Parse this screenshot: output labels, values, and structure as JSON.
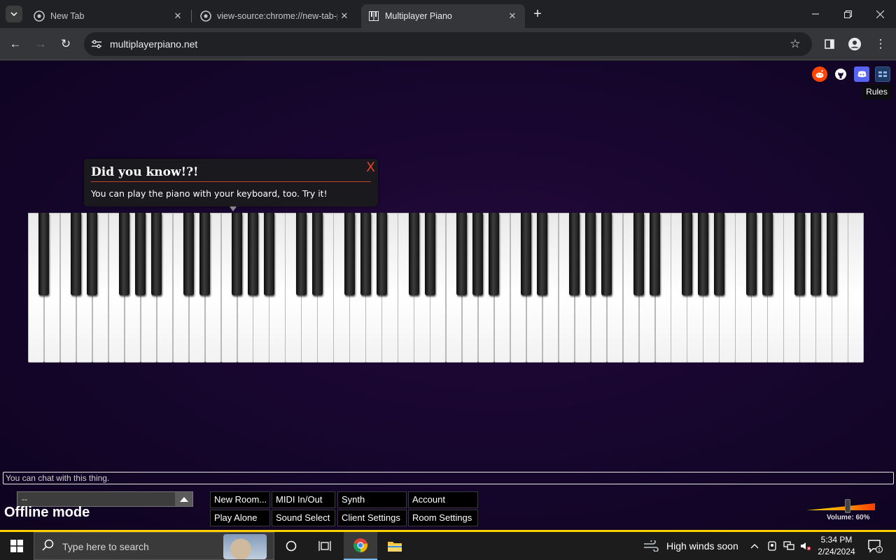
{
  "browser": {
    "tabs": [
      {
        "title": "New Tab",
        "active": false
      },
      {
        "title": "view-source:chrome://new-tab-page/",
        "active": false
      },
      {
        "title": "Multiplayer Piano",
        "active": true
      }
    ],
    "url": "multiplayerpiano.net"
  },
  "page": {
    "rules_label": "Rules",
    "tooltip": {
      "title": "Did you know!?!",
      "body": "You can play the piano with your keyboard, too. Try it!",
      "close": "X"
    },
    "piano": {
      "white_keys": 52,
      "black_keys": 36
    },
    "chat_placeholder": "You can chat with this thing.",
    "room_select_value": "--",
    "status": "Offline mode",
    "buttons": {
      "new_room": "New Room...",
      "midi": "MIDI In/Out",
      "synth": "Synth",
      "account": "Account",
      "play_alone": "Play Alone",
      "sound_select": "Sound Select",
      "client_settings": "Client Settings",
      "room_settings": "Room Settings"
    },
    "volume": {
      "label": "Volume: 60%",
      "level": 0.6
    }
  },
  "taskbar": {
    "search_placeholder": "Type here to search",
    "weather": "High winds soon",
    "time": "5:34 PM",
    "date": "2/24/2024",
    "notification_count": "1"
  },
  "colors": {
    "page_bg": "#190630",
    "accent_red": "#d9432f",
    "volume_start": "#ffd400",
    "volume_end": "#ff3d00",
    "reddit": "#ff4500",
    "discord": "#5865f2"
  }
}
